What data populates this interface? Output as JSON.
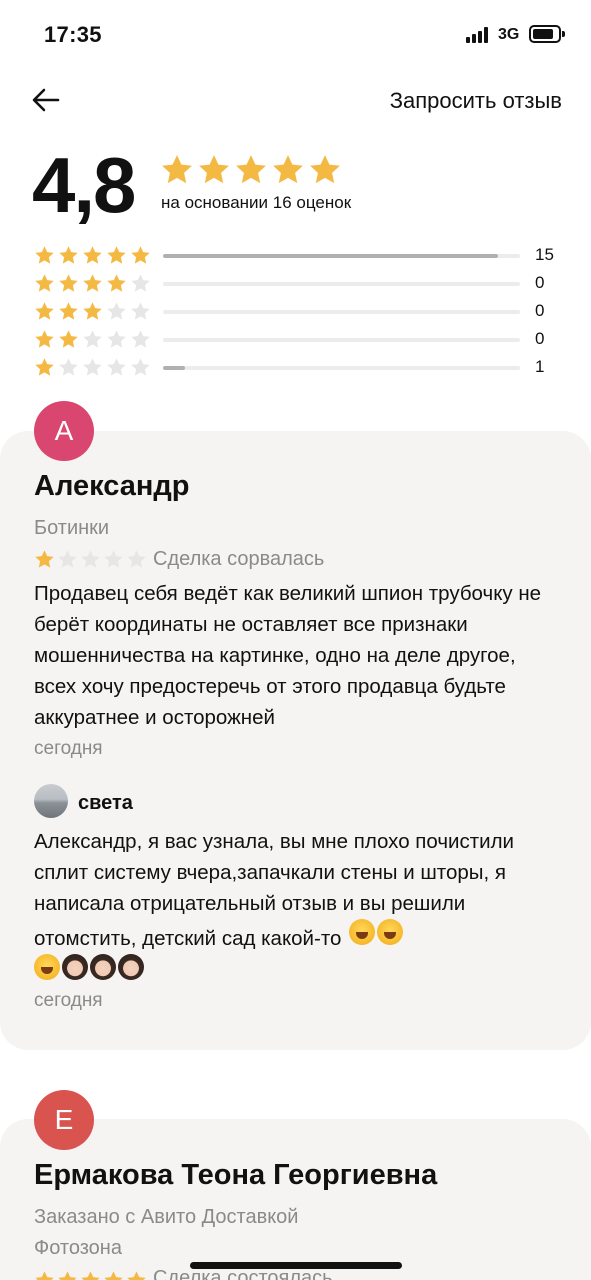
{
  "status_bar": {
    "time": "17:35",
    "network": "3G"
  },
  "header": {
    "request_review": "Запросить отзыв"
  },
  "summary": {
    "rating": "4,8",
    "stars_filled": 5,
    "based_on": "на основании 16 оценок",
    "distribution": [
      {
        "stars": 5,
        "count": "15",
        "fraction": 0.9375
      },
      {
        "stars": 4,
        "count": "0",
        "fraction": 0
      },
      {
        "stars": 3,
        "count": "0",
        "fraction": 0
      },
      {
        "stars": 2,
        "count": "0",
        "fraction": 0
      },
      {
        "stars": 1,
        "count": "1",
        "fraction": 0.0625
      }
    ]
  },
  "reviews": [
    {
      "avatar_letter": "А",
      "avatar_color": "#d9466f",
      "author": "Александр",
      "item": "Ботинки",
      "rating": 1,
      "deal_status": "Сделка сорвалась",
      "text": "Продавец себя ведёт как великий шпион трубочку не берёт координаты не оставляет все признаки мошенничества на картинке, одно на деле  другое, всех хочу предостеречь от этого продавца будьте аккуратнее и осторожней",
      "date": "сегодня",
      "reply": {
        "author": "света",
        "text": "Александр, я вас узнала, вы мне плохо почистили сплит систему вчера,запачкали стены и шторы, я написала отрицательный отзыв и вы решили отомстить, детский сад какой-то",
        "emoji": [
          "face-with-tears-of-joy",
          "face-with-tears-of-joy",
          "face-with-tears-of-joy",
          "woman-facepalming",
          "woman-facepalming",
          "woman-facepalming"
        ],
        "date": "сегодня"
      }
    },
    {
      "avatar_letter": "Е",
      "avatar_color": "#d9534f",
      "author": "Ермакова Теона Георгиевна",
      "item": "Заказано с Авито Доставкой",
      "item_2": "Фотозона",
      "rating": 5,
      "deal_status": "Сделка состоялась"
    }
  ],
  "colors": {
    "star_filled": "#f4b942",
    "star_empty": "#e6e6e6",
    "card_bg": "#f5f4f2",
    "muted_text": "#8a8a8a"
  }
}
